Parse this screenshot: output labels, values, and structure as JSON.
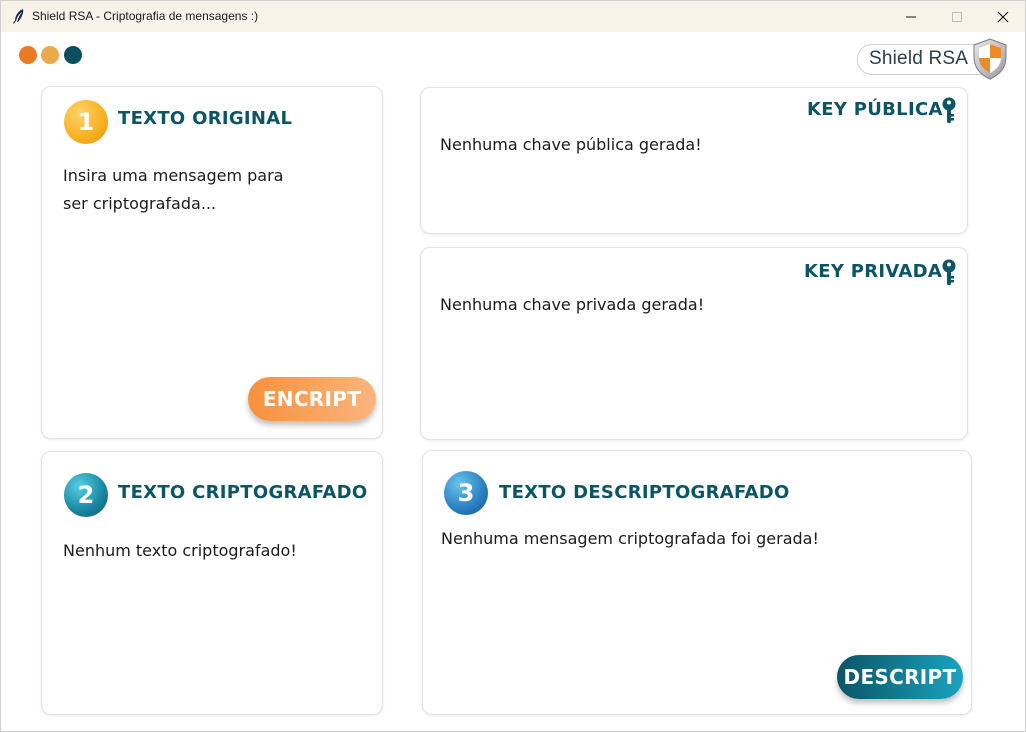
{
  "window": {
    "title": "Shield RSA - Criptografia de mensagens :)"
  },
  "brand": {
    "logo_text": "Shield RSA",
    "dot_colors": [
      "#ec7a25",
      "#eaa94a",
      "#0b4e5e"
    ]
  },
  "original": {
    "step": "1",
    "title": "TEXTO ORIGINAL",
    "placeholder": "Insira uma mensagem para\nser criptografada...",
    "button": "ENCRIPT"
  },
  "public_key": {
    "title": "KEY PÚBLICA",
    "text": "Nenhuma chave pública gerada!",
    "icon": "key-icon"
  },
  "private_key": {
    "title": "KEY PRIVADA",
    "text": "Nenhuma chave privada gerada!",
    "icon": "key-icon"
  },
  "encrypted": {
    "step": "2",
    "title": "TEXTO CRIPTOGRAFADO",
    "text": "Nenhum texto criptografado!"
  },
  "decrypted": {
    "step": "3",
    "title": "TEXTO DESCRIPTOGRAFADO",
    "text": "Nenhuma mensagem criptografada foi gerada!",
    "button": "DESCRIPT"
  },
  "colors": {
    "heading": "#0b5566",
    "accent_orange": "#f7913a",
    "accent_teal": "#0b5566"
  }
}
